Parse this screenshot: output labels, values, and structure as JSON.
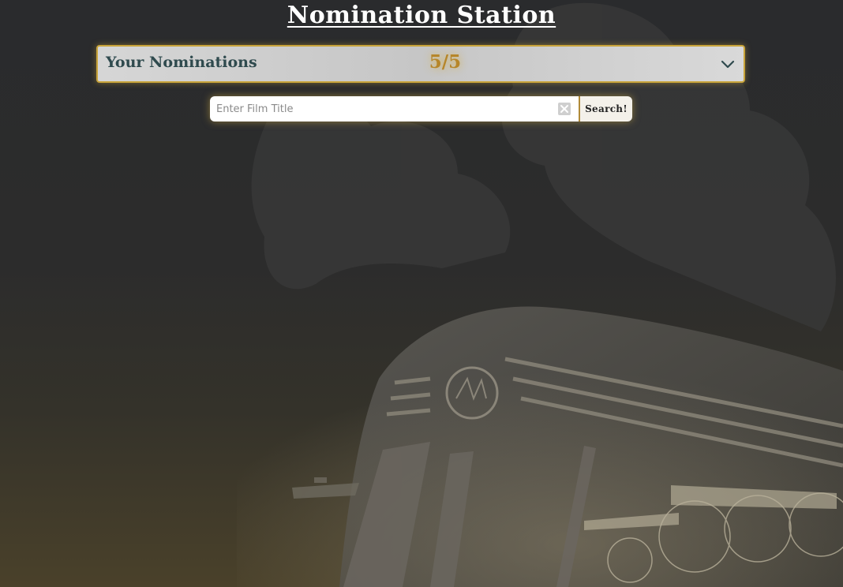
{
  "header": {
    "title": "Nomination Station"
  },
  "nominations": {
    "label": "Your Nominations",
    "count": "5/5",
    "expand_icon": "chevron-down-icon"
  },
  "search": {
    "placeholder": "Enter Film Title",
    "value": "",
    "clear_icon": "clear-x-icon",
    "button_label": "Search!"
  },
  "colors": {
    "accent_gold": "#c9a43a",
    "count_gold": "#b6862a",
    "label_teal": "#2f4a4e"
  }
}
